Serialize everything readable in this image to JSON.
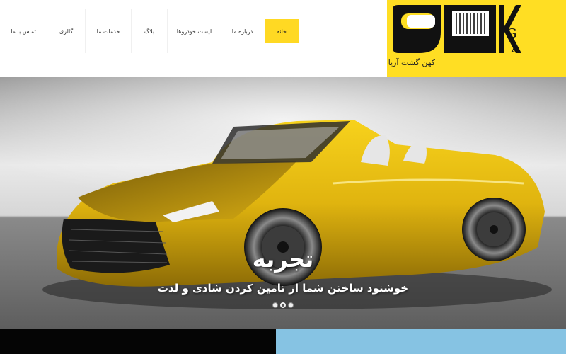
{
  "brand": {
    "caption": "کهن گشت آریا",
    "background": "#ffde23",
    "monogram": "KGA"
  },
  "nav": {
    "items": [
      {
        "label": "خانه",
        "active": true
      },
      {
        "label": "درباره ما",
        "active": false
      },
      {
        "label": "لیست خودروها",
        "active": false
      },
      {
        "label": "بلاگ",
        "active": false
      },
      {
        "label": "خدمات ما",
        "active": false
      },
      {
        "label": "گالری",
        "active": false
      },
      {
        "label": "تماس با ما",
        "active": false
      }
    ],
    "active_color": "#ffd923"
  },
  "hero": {
    "title": "تجربه",
    "subtitle": "خوشنود ساختن شما از تامین کردن شادی و لذت",
    "image": "yellow-convertible-sports-car",
    "slides": 3,
    "active_slide": 2
  },
  "footer_strip": {
    "left_color": "#050505",
    "right_color": "#86c3e3"
  }
}
